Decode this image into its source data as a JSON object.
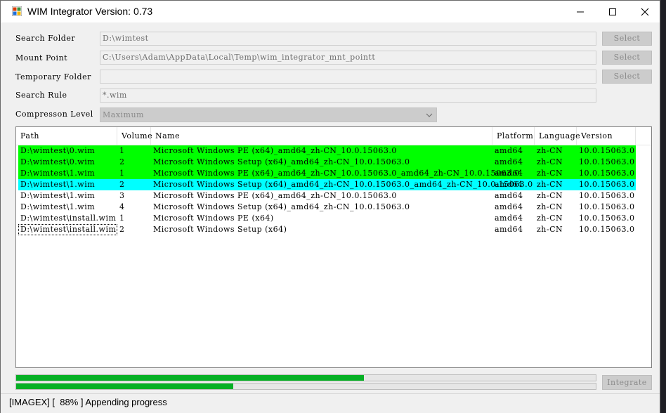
{
  "window": {
    "title": "WIM Integrator Version: 0.73"
  },
  "form": {
    "search_folder": {
      "label": "Search Folder",
      "value": "D:\\wimtest",
      "button": "Select"
    },
    "mount_point": {
      "label": "Mount Point",
      "value": "C:\\Users\\Adam\\AppData\\Local\\Temp\\wim_integrator_mnt_pointt",
      "button": "Select"
    },
    "temporary_folder": {
      "label": "Temporary Folder",
      "value": "",
      "button": "Select"
    },
    "search_rule": {
      "label": "Search Rule",
      "value": "*.wim"
    },
    "compression_level": {
      "label": "Compresson Level",
      "value": "Maximum"
    }
  },
  "list": {
    "columns": [
      "Path",
      "Volume",
      "Name",
      "Platform",
      "Language",
      "Version"
    ],
    "rows": [
      {
        "path": "D:\\wimtest\\0.wim",
        "volume": "1",
        "name": "Microsoft Windows PE (x64)_amd64_zh-CN_10.0.15063.0",
        "platform": "amd64",
        "language": "zh-CN",
        "version": "10.0.15063.0",
        "highlight": "#00ff00"
      },
      {
        "path": "D:\\wimtest\\0.wim",
        "volume": "2",
        "name": "Microsoft Windows Setup (x64)_amd64_zh-CN_10.0.15063.0",
        "platform": "amd64",
        "language": "zh-CN",
        "version": "10.0.15063.0",
        "highlight": "#00ff00"
      },
      {
        "path": "D:\\wimtest\\1.wim",
        "volume": "1",
        "name": "Microsoft Windows PE (x64)_amd64_zh-CN_10.0.15063.0_amd64_zh-CN_10.0.15063.0",
        "platform": "amd64",
        "language": "zh-CN",
        "version": "10.0.15063.0",
        "highlight": "#00ff00"
      },
      {
        "path": "D:\\wimtest\\1.wim",
        "volume": "2",
        "name": "Microsoft Windows Setup (x64)_amd64_zh-CN_10.0.15063.0_amd64_zh-CN_10.0.15063.0",
        "platform": "amd64",
        "language": "zh-CN",
        "version": "10.0.15063.0",
        "highlight": "#00ffff"
      },
      {
        "path": "D:\\wimtest\\1.wim",
        "volume": "3",
        "name": "Microsoft Windows PE (x64)_amd64_zh-CN_10.0.15063.0",
        "platform": "amd64",
        "language": "zh-CN",
        "version": "10.0.15063.0",
        "highlight": ""
      },
      {
        "path": "D:\\wimtest\\1.wim",
        "volume": "4",
        "name": "Microsoft Windows Setup (x64)_amd64_zh-CN_10.0.15063.0",
        "platform": "amd64",
        "language": "zh-CN",
        "version": "10.0.15063.0",
        "highlight": ""
      },
      {
        "path": "D:\\wimtest\\install.wim",
        "volume": "1",
        "name": "Microsoft Windows PE (x64)",
        "platform": "amd64",
        "language": "zh-CN",
        "version": "10.0.15063.0",
        "highlight": ""
      },
      {
        "path": "D:\\wimtest\\install.wim",
        "volume": "2",
        "name": "Microsoft Windows Setup (x64)",
        "platform": "amd64",
        "language": "zh-CN",
        "version": "10.0.15063.0",
        "highlight": ""
      }
    ]
  },
  "progress": {
    "overall": 0.6,
    "current": 0.375,
    "color": "#06b025"
  },
  "integrate_button": "Integrate",
  "status_text": "[IMAGEX] [  88% ] Appending progress"
}
